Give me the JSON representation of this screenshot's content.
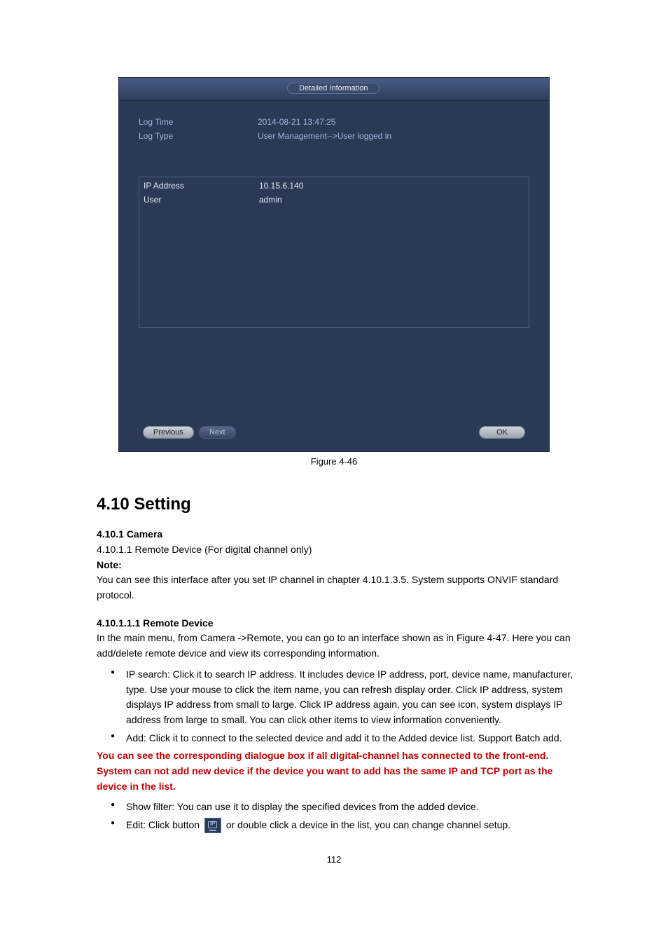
{
  "dialog": {
    "title": "Detailed Information",
    "logTimeLabel": "Log Time",
    "logTimeValue": "2014-08-21 13:47:25",
    "logTypeLabel": "Log Type",
    "logTypeValue": "User Management-->User logged in",
    "ipLabel": "IP Address",
    "ipValue": "10.15.6.140",
    "userLabel": "User",
    "userValue": "admin",
    "btnPrevious": "Previous",
    "btnNext": "Next",
    "btnOK": "OK"
  },
  "figureCaption": "Figure 4-46",
  "sectionTitle": "4.10 Setting",
  "cameraHeading": "4.10.1 Camera",
  "cameraSub": "4.10.1.1 Remote Device (For digital channel only)",
  "noteTitle": "Note:",
  "noteBody": "You can see this interface after you set IP channel in chapter 4.10.1.3.5. System supports ONVIF standard protocol.",
  "searchLead": "In the main menu, from Camera ->Remote, you can go to an interface shown as in Figure 4-47. Here you can add/delete remote device and view its corresponding information.",
  "bullets": [
    "IP search: Click it to search IP address. It includes device IP address, port, device name, manufacturer, type. Use your mouse to click the item name, you can refresh display order. Click IP address, system displays IP address from small to large. Click IP address again, you can see icon, system displays IP address from large to small. You can click other items to view information conveniently.",
    "Add: Click it to connect to the selected device and add it to the Added device list. Support Batch add."
  ],
  "redNote": "You can see the corresponding dialogue box if all digital-channel has connected to the front-end.",
  "redNote2": "System can not add new device if the device you want to add has the same IP and TCP port as the device in the list.",
  "bullets2a": "Show filter: You can use it to display the specified devices from the added device.",
  "bullets2b_before": "Edit: Click button ",
  "bullets2b_after": " or double click a device in the list, you can change channel setup.",
  "pageNumber": "112"
}
